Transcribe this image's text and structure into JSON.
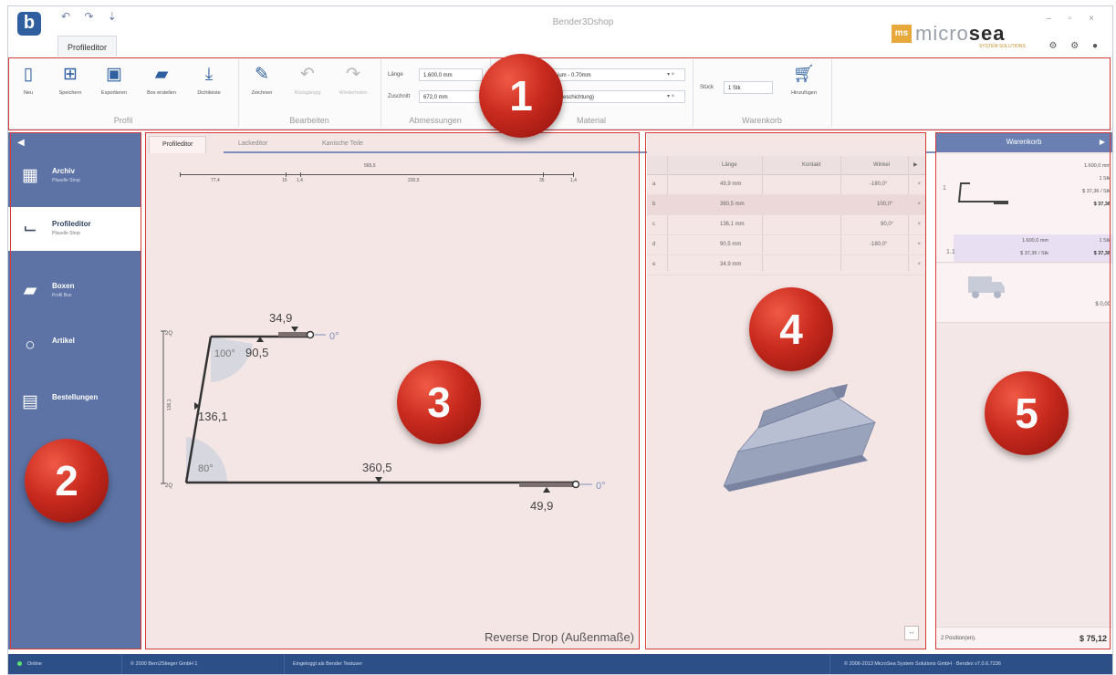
{
  "window": {
    "title": "Bender3Dshop",
    "ribbon_tab": "Profileditor",
    "quick_access": "↶ ↷ ⇣",
    "window_controls": "– ▫ ×",
    "help_controls": "⚙ ⚙ ●",
    "brand": {
      "mark": "ms",
      "text_light": "micro",
      "text_bold": "sea",
      "sub": "SYSTEM SOLUTIONS",
      "accent_color": "#e8a93c"
    }
  },
  "ribbon": {
    "groups": [
      {
        "label": "Profil"
      },
      {
        "label": "Bearbeiten"
      },
      {
        "label": "Abmessungen"
      },
      {
        "label": "Material"
      },
      {
        "label": "Warenkorb"
      }
    ],
    "profil_buttons": [
      {
        "label": "Neu",
        "icon": "new-document-icon"
      },
      {
        "label": "Speichern",
        "icon": "grid-icon"
      },
      {
        "label": "Exportieren",
        "icon": "floppy-icon"
      },
      {
        "label": "Box erstellen",
        "icon": "box-icon"
      },
      {
        "label": "Dichtleiste",
        "icon": "download-icon"
      }
    ],
    "edit_buttons": [
      {
        "label": "Zeichnen",
        "icon": "draw-icon"
      },
      {
        "label": "Rückgängig",
        "icon": "undo-icon"
      },
      {
        "label": "Wiederholen",
        "icon": "redo-icon"
      }
    ],
    "dimensions": {
      "length_label": "Länge",
      "length_value": "1.600,0 mm",
      "blank_label": "Zuschnitt",
      "blank_value": "672,0 mm"
    },
    "material": {
      "value1": "...ium - 0.70mm",
      "value2": "...(Beschichtung)",
      "clear": "▾ ×"
    },
    "cart": {
      "qty_label": "Stück",
      "qty_value": "1 Stk",
      "add_label": "Hinzufügen"
    }
  },
  "sidebar": {
    "collapse_label": "◀",
    "items": [
      {
        "title": "Archiv",
        "subtitle": "Pfavelle Shop",
        "icon": "archive-icon",
        "glyph": "▦"
      },
      {
        "title": "Profileditor",
        "subtitle": "Pfavelle Shop",
        "icon": "profile-editor-icon",
        "glyph": "⌙"
      },
      {
        "title": "Boxen",
        "subtitle": "Profil Box",
        "icon": "boxes-icon",
        "glyph": "▰"
      },
      {
        "title": "Artikel",
        "subtitle": "",
        "icon": "article-icon",
        "glyph": "○"
      },
      {
        "title": "Bestellungen",
        "subtitle": "",
        "icon": "orders-icon",
        "glyph": "▤"
      }
    ]
  },
  "editor": {
    "tabs": [
      "Profileditor",
      "Lackeditor",
      "Kanische Teile"
    ],
    "ruler": {
      "total": "565,5",
      "segments": [
        "77,4",
        "15",
        "1,4",
        "230,5",
        "35",
        "1,4"
      ]
    },
    "dims": {
      "top_flange": "34,9",
      "top_bend": "90,5",
      "angle_top": "100°",
      "side": "136,1",
      "angle_bottom": "80°",
      "base": "360,5",
      "bottom_hem": "49,9",
      "angle_right_top": "0°",
      "angle_right_bottom": "0°",
      "height_top": "2Q",
      "height_bottom": "2Q",
      "height_total": "136,1"
    },
    "caption": "Reverse Drop (Außenmaße)"
  },
  "table": {
    "headers": [
      "",
      "Länge",
      "Kontakt",
      "Winkel"
    ],
    "rows": [
      {
        "id": "a",
        "length": "49,9 mm",
        "angle": "-180,0°"
      },
      {
        "id": "b",
        "length": "360,5 mm",
        "angle": "100,0°"
      },
      {
        "id": "c",
        "length": "136,1 mm",
        "angle": "90,0°"
      },
      {
        "id": "d",
        "length": "90,5 mm",
        "angle": "-180,0°"
      },
      {
        "id": "e",
        "length": "34,9 mm",
        "angle": ""
      }
    ],
    "close_glyph": "×",
    "nav_glyph": "▶",
    "action_glyph": "↔"
  },
  "cart": {
    "title": "Warenkorb",
    "arrow": "▶",
    "item_index": "1",
    "lines": [
      "1.600,0 mm",
      "1 Stk",
      "$ 37,36 / Stk",
      "$ 37,36"
    ],
    "sub_index": "1.1",
    "sub_length": "1.600,0 mm",
    "sub_qty": "1 Stk",
    "sub_price": "$ 37,36 / Stk",
    "sub_total": "$ 37,36",
    "shipping_total": "$ 0,00",
    "footer_count": "2 Position(en).",
    "footer_sum": "$ 75,12"
  },
  "badges": [
    "1",
    "2",
    "3",
    "4",
    "5"
  ],
  "status": {
    "state": "Online",
    "copyright1": "© 2000 Bern2Stieger GmbH 1",
    "login": "Eingeloggt als Bender Testuser",
    "copyright2": "© 2006-2013 MicroSea System Solutions GmbH · Bendex v7.0.6.7236"
  },
  "colors": {
    "sidebar": "#5d73a5",
    "statusbar": "#2b4f86",
    "badge": "#c92a1e",
    "highlight": "#d43a3a",
    "panel_tint": "#f5e6e6"
  }
}
